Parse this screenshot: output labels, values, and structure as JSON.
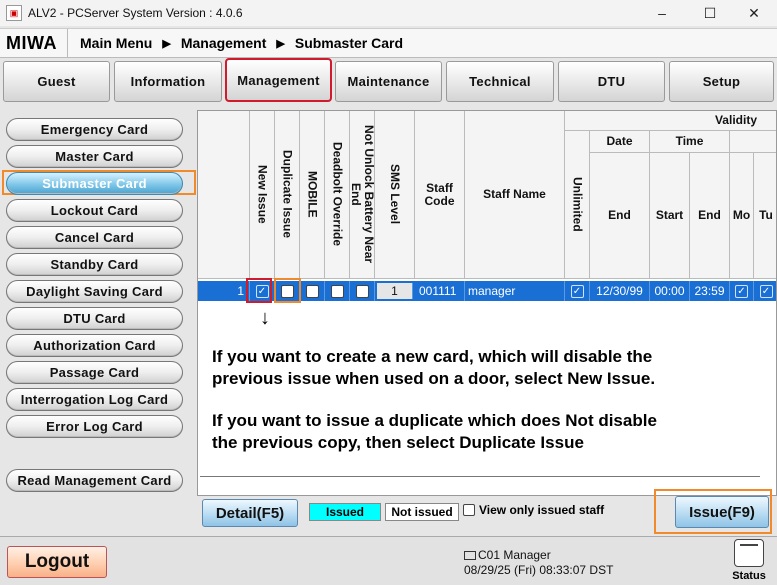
{
  "window": {
    "title": "ALV2 - PCServer System Version : 4.0.6",
    "minimize_glyph": "–",
    "maximize_glyph": "☐",
    "close_glyph": "✕"
  },
  "header": {
    "logo": "MIWA",
    "breadcrumb": [
      "Main Menu",
      "Management",
      "Submaster Card"
    ]
  },
  "tabs": [
    "Guest",
    "Information",
    "Management",
    "Maintenance",
    "Technical",
    "DTU",
    "Setup"
  ],
  "active_tab": "Management",
  "sidebar": {
    "items": [
      "Emergency Card",
      "Master Card",
      "Submaster Card",
      "Lockout Card",
      "Cancel Card",
      "Standby Card",
      "Daylight Saving Card",
      "DTU Card",
      "Authorization Card",
      "Passage Card",
      "Interrogation Log Card",
      "Error Log Card"
    ],
    "active_item": "Submaster Card",
    "read_button": "Read Management Card"
  },
  "grid": {
    "headers": {
      "new_issue": "New Issue",
      "duplicate_issue": "Duplicate Issue",
      "mobile": "MOBILE",
      "deadbolt_override": "Deadbolt Override",
      "not_unlock_battery": "Not Unlock Battery Near End",
      "sms_level": "SMS Level",
      "staff_code": "Staff Code",
      "staff_name": "Staff Name",
      "unlimited": "Unlimited",
      "validity": "Validity",
      "date": "Date",
      "time": "Time",
      "end": "End",
      "start": "Start",
      "time_end": "End",
      "mo": "Mo",
      "tu": "Tu"
    },
    "row": {
      "index": "1",
      "new_issue": true,
      "duplicate_issue": false,
      "mobile": false,
      "deadbolt_override": false,
      "not_unlock_battery": false,
      "sms_level": "1",
      "staff_code": "001111",
      "staff_name": "manager",
      "unlimited": true,
      "date_end": "12/30/99",
      "time_start": "00:00",
      "time_end": "23:59",
      "mo": true,
      "tu": true
    }
  },
  "annotation": {
    "arrow": "↓",
    "line1": "If you want to create a new card, which will disable the",
    "line2": "previous issue when used on a door, select New Issue.",
    "line3": "If you want to issue a duplicate which does Not disable",
    "line4": "the previous copy, then select Duplicate Issue"
  },
  "bottombar": {
    "detail_button": "Detail(F5)",
    "legend_issued": "Issued",
    "legend_not_issued": "Not issued",
    "view_only": "View only issued staff",
    "issue_button": "Issue(F9)"
  },
  "footer": {
    "logout": "Logout",
    "station": "C01 Manager",
    "datetime": "08/29/25 (Fri) 08:33:07 DST",
    "status": "Status"
  },
  "colors": {
    "selection": "#1a6fd4",
    "issued": "#00ffff",
    "highlight_red": "#d11b2c",
    "highlight_orange": "#f08a2b"
  }
}
